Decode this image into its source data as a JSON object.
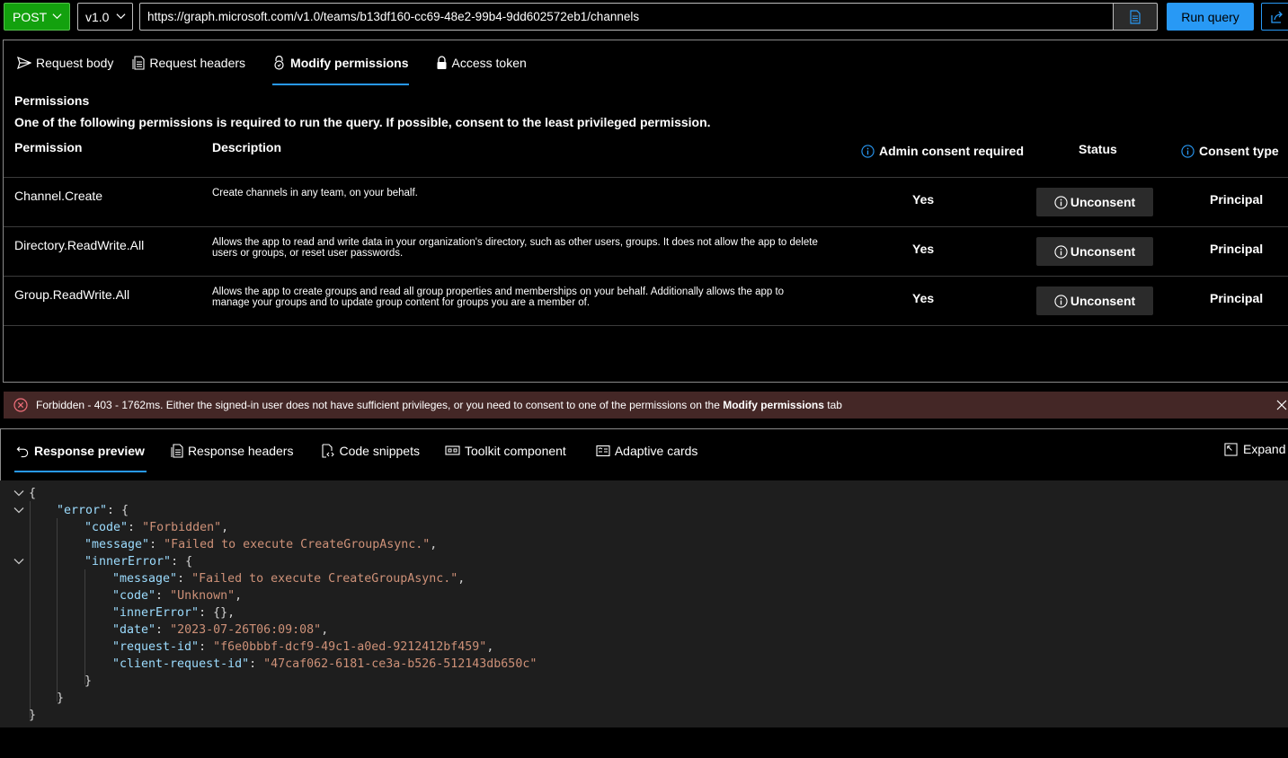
{
  "topbar": {
    "method": "POST",
    "version": "v1.0",
    "url": "https://graph.microsoft.com/v1.0/teams/b13df160-cc69-48e2-99b4-9dd602572eb1/channels",
    "run_label": "Run query"
  },
  "request_tabs": [
    {
      "label": "Request body",
      "icon": "send-icon"
    },
    {
      "label": "Request headers",
      "icon": "document-headers-icon"
    },
    {
      "label": "Modify permissions",
      "icon": "lock-shield-icon",
      "active": true
    },
    {
      "label": "Access token",
      "icon": "lock-icon"
    }
  ],
  "permissions": {
    "title": "Permissions",
    "subtitle": "One of the following permissions is required to run the query. If possible, consent to the least privileged permission.",
    "columns": {
      "permission": "Permission",
      "description": "Description",
      "admin": "Admin consent required",
      "status": "Status",
      "consent_type": "Consent type"
    },
    "rows": [
      {
        "permission": "Channel.Create",
        "description": "Create channels in any team, on your behalf.",
        "admin": "Yes",
        "status": "Unconsent",
        "consent_type": "Principal"
      },
      {
        "permission": "Directory.ReadWrite.All",
        "description": "Allows the app to read and write data in your organization's directory, such as other users, groups. It does not allow the app to delete users or groups, or reset user passwords.",
        "admin": "Yes",
        "status": "Unconsent",
        "consent_type": "Principal"
      },
      {
        "permission": "Group.ReadWrite.All",
        "description": "Allows the app to create groups and read all group properties and memberships on your behalf. Additionally allows the app to manage your groups and to update group content for groups you are a member of.",
        "admin": "Yes",
        "status": "Unconsent",
        "consent_type": "Principal"
      }
    ]
  },
  "error_bar": {
    "message_prefix": "Forbidden - 403 - 1762ms. Either the signed-in user does not have sufficient privileges, or you need to consent to one of the permissions on the ",
    "message_bold": "Modify permissions",
    "message_suffix": " tab"
  },
  "response_tabs": [
    {
      "label": "Response preview",
      "icon": "undo-arrow-icon",
      "active": true
    },
    {
      "label": "Response headers",
      "icon": "document-headers-icon"
    },
    {
      "label": "Code snippets",
      "icon": "code-doc-icon"
    },
    {
      "label": "Toolkit component",
      "icon": "toolkit-icon"
    },
    {
      "label": "Adaptive cards",
      "icon": "card-icon"
    }
  ],
  "expand_label": "Expand",
  "response_json": {
    "open_brace": "{",
    "error_key": "\"error\"",
    "code_key": "\"code\"",
    "code_val": "\"Forbidden\"",
    "message_key": "\"message\"",
    "message_val": "\"Failed to execute CreateGroupAsync.\"",
    "inner_key": "\"innerError\"",
    "inner_message_key": "\"message\"",
    "inner_message_val": "\"Failed to execute CreateGroupAsync.\"",
    "inner_code_key": "\"code\"",
    "inner_code_val": "\"Unknown\"",
    "inner_inner_key": "\"innerError\"",
    "inner_inner_val": "{}",
    "date_key": "\"date\"",
    "date_val": "\"2023-07-26T06:09:08\"",
    "request_id_key": "\"request-id\"",
    "request_id_val": "\"f6e0bbbf-dcf9-49c1-a0ed-9212412bf459\"",
    "client_request_id_key": "\"client-request-id\"",
    "client_request_id_val": "\"47caf062-6181-ce3a-b526-512143db650c\"",
    "close_brace": "}"
  },
  "colors": {
    "accent": "#2899f5",
    "method_green": "#13a10e",
    "error_bg": "#442726",
    "json_key": "#9cdcfe",
    "json_string": "#ce9178"
  }
}
